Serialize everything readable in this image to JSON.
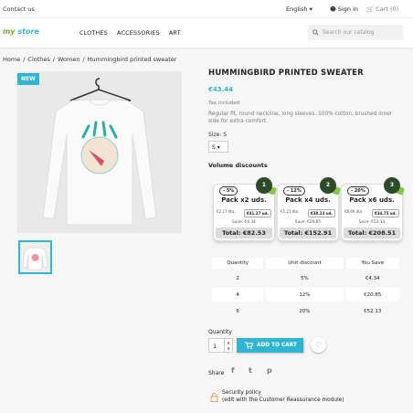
{
  "topbar": {
    "contact": "Contact us",
    "language": "English",
    "signin": "Sign in",
    "cart": "Cart (0)"
  },
  "header": {
    "logo_my": "my",
    "logo_store": "store",
    "search_placeholder": "Search our catalog"
  },
  "nav": [
    "CLOTHES",
    "ACCESSORIES",
    "ART"
  ],
  "breadcrumb": [
    "Home",
    "Clothes",
    "Women",
    "Hummingbird printed sweater"
  ],
  "gallery": {
    "badge": "NEW"
  },
  "product": {
    "title": "HUMMINGBIRD PRINTED SWEATER",
    "price": "€43.44",
    "tax_label": "Tax included",
    "description": "Regular fit, round neckline, long sleeves. 100% cotton, brushed inner side for extra comfort.",
    "size_label": "Size: S",
    "size_value": "S"
  },
  "volume": {
    "heading": "Volume discounts",
    "packs": [
      {
        "pct": "- 5%",
        "bag": "1",
        "title": "Pack x2 uds.",
        "old_unit": "€2.17 dto.",
        "unit_price": "€41.27 ud.",
        "save": "Save: €4.34",
        "total": "Total: €82.53"
      },
      {
        "pct": "- 12%",
        "bag": "2",
        "title": "Pack x4 uds.",
        "old_unit": "€5.21 dto.",
        "unit_price": "€38.23 ud.",
        "save": "Save: €20.85",
        "total": "Total: €152.91"
      },
      {
        "pct": "- 20%",
        "bag": "3",
        "title": "Pack x6 uds.",
        "old_unit": "€8.69 dto.",
        "unit_price": "€34.75 ud.",
        "save": "Save: €52.13",
        "total": "Total: €208.51"
      }
    ],
    "table_headers": [
      "Quantity",
      "Unit discount",
      "You Save"
    ],
    "table_rows": [
      [
        "2",
        "5%",
        "€4.34"
      ],
      [
        "4",
        "12%",
        "€20.85"
      ],
      [
        "6",
        "20%",
        "€52.13"
      ]
    ]
  },
  "purchase": {
    "qty_label": "Quantity",
    "qty_value": "1",
    "add_label": "ADD TO CART"
  },
  "share": {
    "label": "Share",
    "icons": [
      "facebook-icon",
      "twitter-icon",
      "pinterest-icon"
    ]
  },
  "reassurance": {
    "line1": "Security policy",
    "line2": "(edit with the Customer Reassurance module)"
  },
  "colors": {
    "accent": "#2fb5d2",
    "background": "#f6f6f6"
  }
}
